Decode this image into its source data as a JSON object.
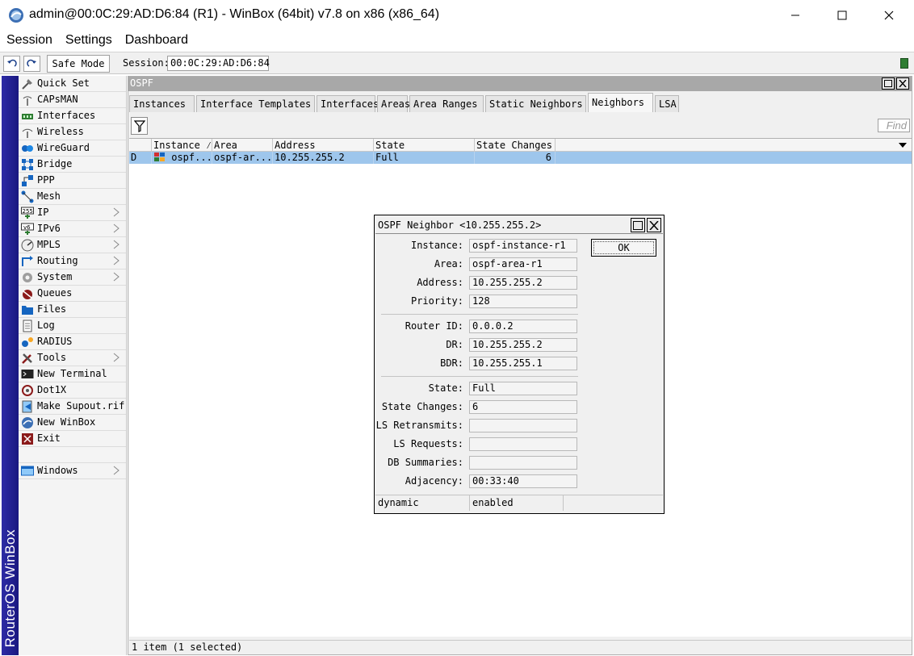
{
  "window": {
    "title": "admin@00:0C:29:AD:D6:84 (R1) - WinBox (64bit) v7.8 on x86 (x86_64)"
  },
  "menu": [
    "Session",
    "Settings",
    "Dashboard"
  ],
  "toolbar": {
    "safe_mode_label": "Safe Mode",
    "session_label": "Session:",
    "session_value": "00:0C:29:AD:D6:84"
  },
  "brand": "RouterOS WinBox",
  "sidebar": {
    "items": [
      {
        "label": "Quick Set",
        "icon": "quick-set-icon",
        "submenu": false
      },
      {
        "label": "CAPsMAN",
        "icon": "capsman-icon",
        "submenu": false
      },
      {
        "label": "Interfaces",
        "icon": "interfaces-icon",
        "submenu": false
      },
      {
        "label": "Wireless",
        "icon": "wireless-icon",
        "submenu": false
      },
      {
        "label": "WireGuard",
        "icon": "wireguard-icon",
        "submenu": false
      },
      {
        "label": "Bridge",
        "icon": "bridge-icon",
        "submenu": false
      },
      {
        "label": "PPP",
        "icon": "ppp-icon",
        "submenu": false
      },
      {
        "label": "Mesh",
        "icon": "mesh-icon",
        "submenu": false
      },
      {
        "label": "IP",
        "icon": "ip-icon",
        "submenu": true
      },
      {
        "label": "IPv6",
        "icon": "ipv6-icon",
        "submenu": true
      },
      {
        "label": "MPLS",
        "icon": "mpls-icon",
        "submenu": true
      },
      {
        "label": "Routing",
        "icon": "routing-icon",
        "submenu": true
      },
      {
        "label": "System",
        "icon": "system-icon",
        "submenu": true
      },
      {
        "label": "Queues",
        "icon": "queues-icon",
        "submenu": false
      },
      {
        "label": "Files",
        "icon": "files-icon",
        "submenu": false
      },
      {
        "label": "Log",
        "icon": "log-icon",
        "submenu": false
      },
      {
        "label": "RADIUS",
        "icon": "radius-icon",
        "submenu": false
      },
      {
        "label": "Tools",
        "icon": "tools-icon",
        "submenu": true
      },
      {
        "label": "New Terminal",
        "icon": "terminal-icon",
        "submenu": false
      },
      {
        "label": "Dot1X",
        "icon": "dot1x-icon",
        "submenu": false
      },
      {
        "label": "Make Supout.rif",
        "icon": "supout-icon",
        "submenu": false
      },
      {
        "label": "New WinBox",
        "icon": "winbox-icon",
        "submenu": false
      },
      {
        "label": "Exit",
        "icon": "exit-icon",
        "submenu": false
      }
    ],
    "windows_label": "Windows"
  },
  "ospf": {
    "title": "OSPF",
    "tabs": [
      "Instances",
      "Interface Templates",
      "Interfaces",
      "Areas",
      "Area Ranges",
      "Static Neighbors",
      "Neighbors",
      "LSA"
    ],
    "active_tab": "Neighbors",
    "find_placeholder": "Find",
    "columns": [
      "Instance",
      "Area",
      "Address",
      "State",
      "State Changes"
    ],
    "rows": [
      {
        "flag": "D",
        "instance": "ospf...",
        "area": "ospf-ar...",
        "address": "10.255.255.2",
        "state": "Full",
        "state_changes": "6"
      }
    ],
    "status": "1 item (1 selected)"
  },
  "dialog": {
    "title": "OSPF Neighbor <10.255.255.2>",
    "ok_label": "OK",
    "fields": {
      "instance": {
        "label": "Instance:",
        "value": "ospf-instance-r1"
      },
      "area": {
        "label": "Area:",
        "value": "ospf-area-r1"
      },
      "address": {
        "label": "Address:",
        "value": "10.255.255.2"
      },
      "priority": {
        "label": "Priority:",
        "value": "128"
      },
      "router_id": {
        "label": "Router ID:",
        "value": "0.0.0.2"
      },
      "dr": {
        "label": "DR:",
        "value": "10.255.255.2"
      },
      "bdr": {
        "label": "BDR:",
        "value": "10.255.255.1"
      },
      "state": {
        "label": "State:",
        "value": "Full"
      },
      "state_changes": {
        "label": "State Changes:",
        "value": "6"
      },
      "ls_retransmits": {
        "label": "LS Retransmits:",
        "value": ""
      },
      "ls_requests": {
        "label": "LS Requests:",
        "value": ""
      },
      "db_summaries": {
        "label": "DB Summaries:",
        "value": ""
      },
      "adjacency": {
        "label": "Adjacency:",
        "value": "00:33:40"
      }
    },
    "status": [
      "dynamic",
      "enabled",
      ""
    ]
  },
  "colors": {
    "brand_strip": "#2d2ba6",
    "selected_row": "#9ec6ec",
    "inactive_title": "#a8a8a8"
  }
}
